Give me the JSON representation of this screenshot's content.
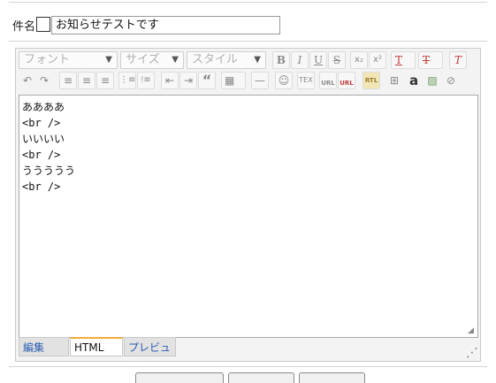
{
  "subject": {
    "label": "件名",
    "value": "お知らせテストです"
  },
  "toolbar": {
    "font_combo": "フォント",
    "size_combo": "サイズ",
    "style_combo": "スタイル",
    "bold": "B",
    "italic": "I",
    "underline": "U",
    "strike": "S",
    "subscript": "x₂",
    "superscript": "x²",
    "text_color": "T",
    "bg_color": "T",
    "remove_format": "T",
    "undo": "↶",
    "redo": "↷",
    "align_left": "≡",
    "align_center": "≡",
    "align_right": "≡",
    "numbered_list": "⋮≡",
    "bulleted_list": "⁝≡",
    "outdent": "⇤",
    "indent": "⇥",
    "blockquote": "“",
    "table": "▦",
    "horizontal_rule": "—",
    "smiley": "☺",
    "tex": "TEX",
    "link_label": "URL",
    "unlink_label": "URL",
    "rtl_label": "RTL",
    "image": "⊞",
    "amazon": "a",
    "picture": "▨",
    "attach": "⊘"
  },
  "editor": {
    "content": "ああああ\n<br />\nいいいい\n<br />\nううううう\n<br />"
  },
  "mode_tabs": [
    {
      "label": "編集"
    },
    {
      "label": "HTML"
    },
    {
      "label": "プレビュー"
    }
  ],
  "colors": {
    "active_tab_accent": "#f2a93b",
    "tab_link": "#2a5db0",
    "red_icon": "#c23b3b"
  }
}
